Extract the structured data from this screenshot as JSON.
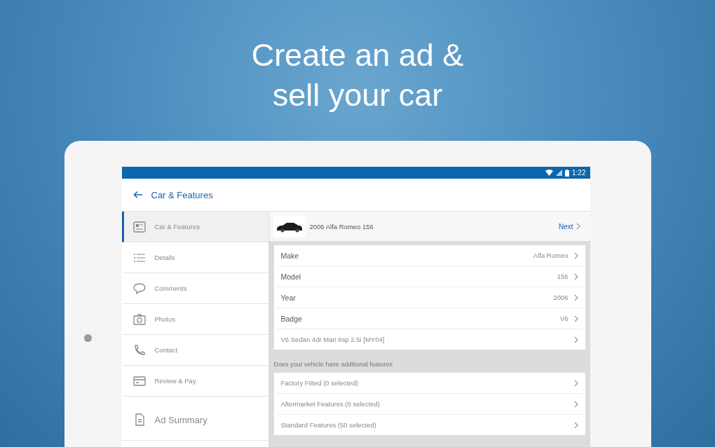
{
  "headline": [
    "Create an ad &",
    "sell your car"
  ],
  "status_bar": {
    "time": "1:22"
  },
  "app_bar": {
    "title": "Car & Features"
  },
  "sidebar": {
    "items": [
      {
        "kind": "step",
        "label": "Car & Features",
        "selected": true
      },
      {
        "kind": "step",
        "label": "Details",
        "selected": false
      },
      {
        "kind": "step",
        "label": "Comments",
        "selected": false
      },
      {
        "kind": "step",
        "label": "Photos",
        "selected": false
      },
      {
        "kind": "step",
        "label": "Contact",
        "selected": false
      },
      {
        "kind": "step",
        "label": "Review & Pay",
        "selected": false
      },
      {
        "kind": "summary",
        "label": "Ad Summary",
        "selected": false
      }
    ]
  },
  "vehicle": {
    "title": "2006 Alfa Romeo 156",
    "next": "Next"
  },
  "fields": [
    {
      "label": "Make",
      "value": "Alfa Romeo"
    },
    {
      "label": "Model",
      "value": "156"
    },
    {
      "label": "Year",
      "value": "2006"
    },
    {
      "label": "Badge",
      "value": "V6"
    },
    {
      "label": "V6 Sedan 4dr Man 6sp 2.5i [MY04]"
    }
  ],
  "features": {
    "prompt": "Does your vehicle have additional features",
    "items": [
      "Factory Fitted (0 selected)",
      "Aftermarket Features (0 selected)",
      "Standard Features (50 selected)"
    ]
  }
}
